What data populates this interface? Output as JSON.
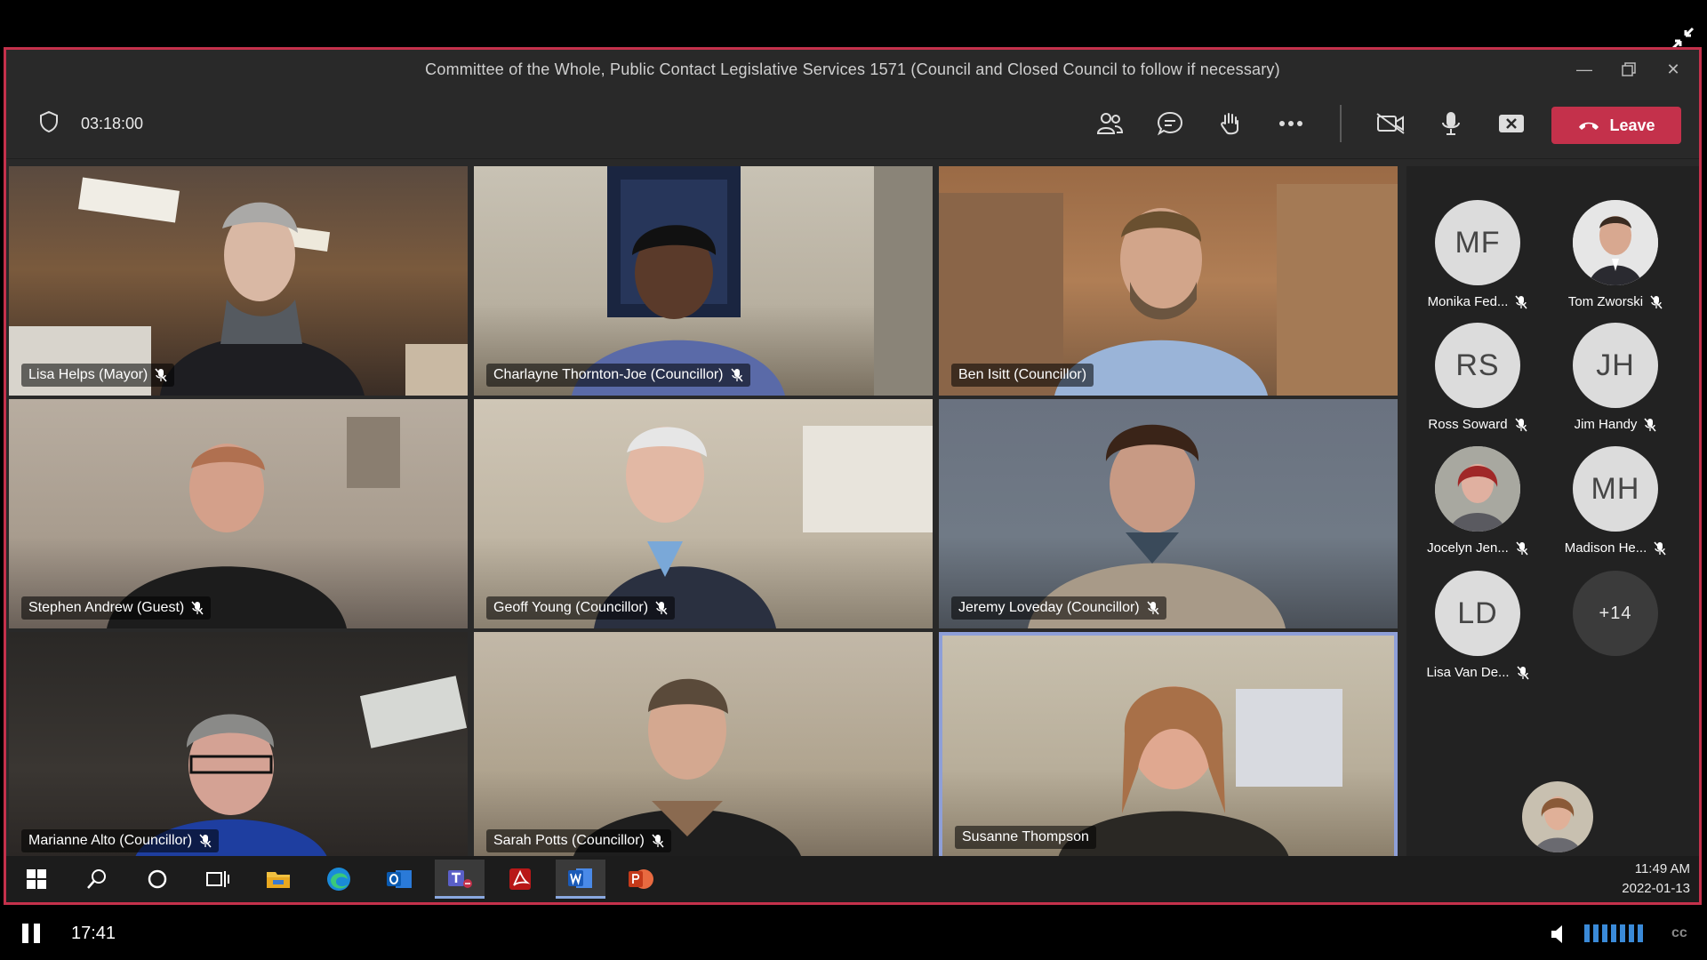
{
  "window": {
    "title": "Committee of the Whole, Public Contact Legislative Services 1571 (Council and Closed Council to follow if necessary)"
  },
  "toolbar": {
    "timer": "03:18:00",
    "leave_label": "Leave"
  },
  "participants": [
    {
      "name": "Lisa Helps (Mayor)",
      "muted": true
    },
    {
      "name": "Charlayne Thornton-Joe (Councillor)",
      "muted": true
    },
    {
      "name": "Ben Isitt (Councillor)",
      "muted": false
    },
    {
      "name": "Stephen Andrew (Guest)",
      "muted": true
    },
    {
      "name": "Geoff Young (Councillor)",
      "muted": true
    },
    {
      "name": "Jeremy Loveday (Councillor)",
      "muted": true
    },
    {
      "name": "Marianne Alto (Councillor)",
      "muted": true
    },
    {
      "name": "Sarah Potts (Councillor)",
      "muted": true
    },
    {
      "name": "Susanne Thompson",
      "muted": false,
      "speaking": true
    }
  ],
  "roster": [
    {
      "initials": "MF",
      "name": "Monika Fed...",
      "muted": true
    },
    {
      "initials": "",
      "name": "Tom Zworski",
      "muted": true,
      "photo": true
    },
    {
      "initials": "RS",
      "name": "Ross Soward",
      "muted": true
    },
    {
      "initials": "JH",
      "name": "Jim Handy",
      "muted": true
    },
    {
      "initials": "",
      "name": "Jocelyn Jen...",
      "muted": true,
      "photo": true
    },
    {
      "initials": "MH",
      "name": "Madison He...",
      "muted": true
    },
    {
      "initials": "LD",
      "name": "Lisa Van De...",
      "muted": true
    },
    {
      "initials": "+14",
      "name": "",
      "more": true
    }
  ],
  "taskbar": {
    "time": "11:49 AM",
    "date": "2022-01-13",
    "apps": [
      "start-icon",
      "search-icon",
      "cortana-icon",
      "task-view-icon",
      "file-explorer-icon",
      "edge-icon",
      "outlook-icon",
      "teams-icon",
      "acrobat-icon",
      "word-icon",
      "powerpoint-icon"
    ]
  },
  "player": {
    "time": "17:41",
    "cc_label": "cc"
  },
  "colors": {
    "accent_border": "#c4314b",
    "leave": "#c4314b",
    "active_speaker": "#8e9fd8"
  }
}
